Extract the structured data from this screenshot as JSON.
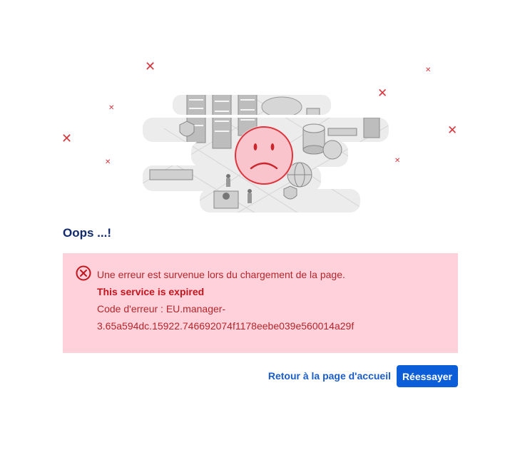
{
  "error_page": {
    "title": "Oops ...!",
    "alert": {
      "message": "Une erreur est survenue lors du chargement de la page.",
      "detail": "This service is expired",
      "code_line1": "Code d'erreur : EU.manager-",
      "code_line2": "3.65a594dc.15922.746692074f1178eebe039e560014a29f"
    },
    "actions": {
      "home_link": "Retour à la page d'accueil",
      "retry_button": "Réessayer"
    }
  },
  "colors": {
    "title": "#102a6b",
    "alert_background": "#ffd1db",
    "alert_text": "#b3262b",
    "link": "#1a5dc9",
    "button": "#0b5ed7",
    "cross_marks": "#d9363e"
  },
  "icons": [
    "sad-face-icon",
    "error-circle-x-icon",
    "cross-mark-icon"
  ]
}
